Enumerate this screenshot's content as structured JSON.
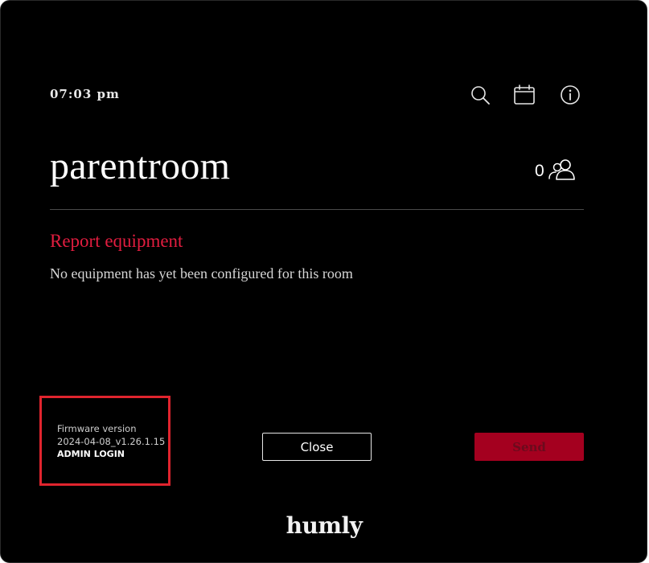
{
  "header": {
    "time": "07:03 pm",
    "icons": [
      "search-icon",
      "calendar-icon",
      "info-icon"
    ]
  },
  "room": {
    "name": "parentroom",
    "occupancy_count": "0",
    "occupancy_icon": "people-icon"
  },
  "report": {
    "title": "Report equipment",
    "message": "No equipment has yet been configured for this room"
  },
  "firmware": {
    "label": "Firmware version",
    "version": "2024-04-08_v1.26.1.15",
    "admin_login": "ADMIN LOGIN"
  },
  "actions": {
    "close_label": "Close",
    "send_label": "Send"
  },
  "branding": {
    "logo_text": "humly"
  },
  "colors": {
    "background": "#000000",
    "accent": "#e11d3f",
    "send_button": "#a4001f",
    "highlight": "#e0242e"
  }
}
